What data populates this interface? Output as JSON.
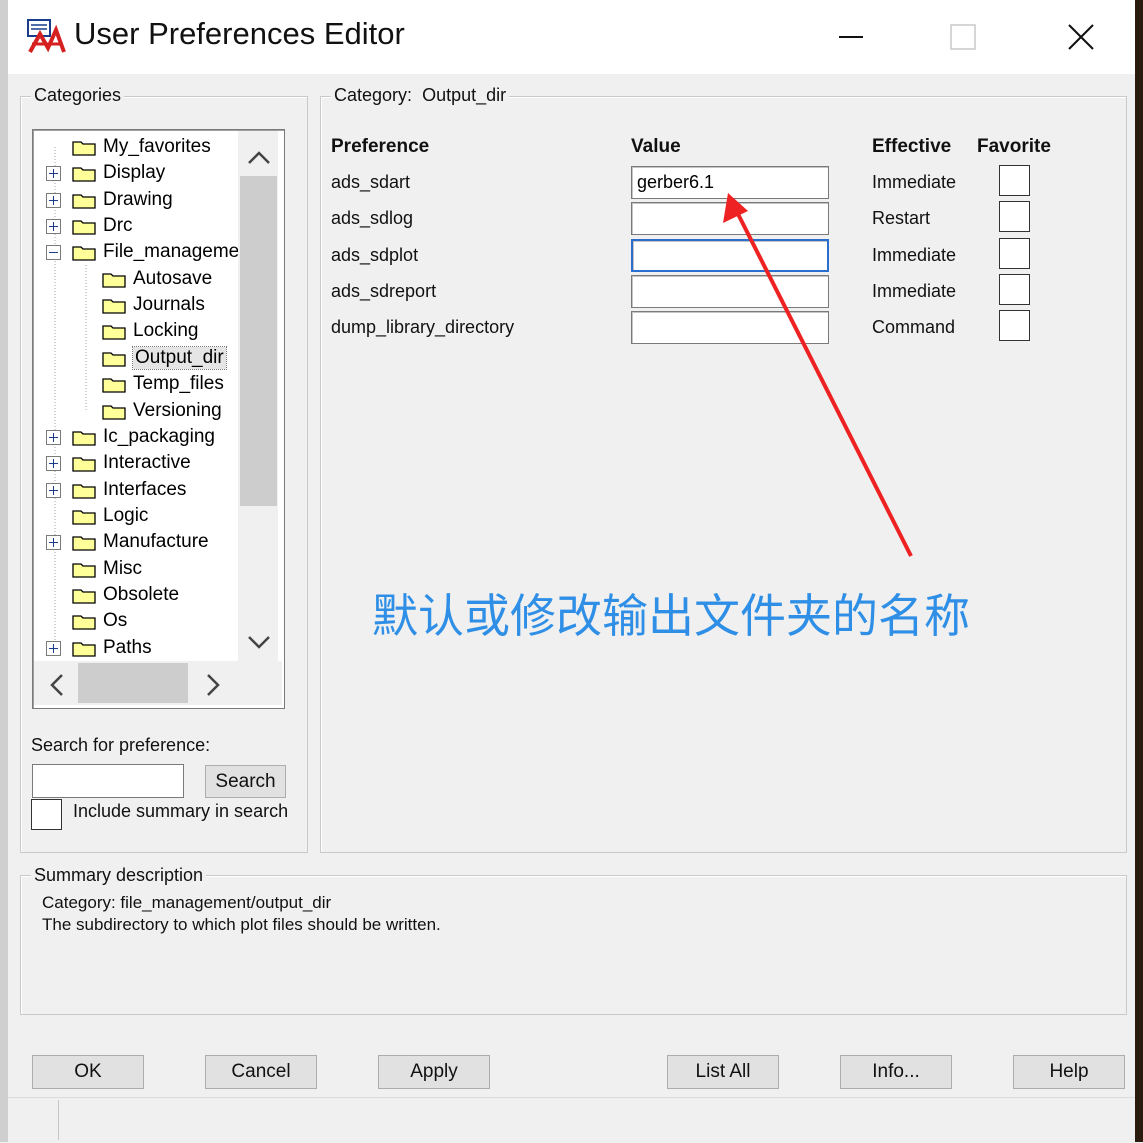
{
  "window": {
    "title": "User Preferences Editor"
  },
  "categories": {
    "label": "Categories",
    "tree": [
      {
        "label": "My_favorites",
        "expander": "none",
        "level": 0
      },
      {
        "label": "Display",
        "expander": "plus",
        "level": 0
      },
      {
        "label": "Drawing",
        "expander": "plus",
        "level": 0
      },
      {
        "label": "Drc",
        "expander": "plus",
        "level": 0
      },
      {
        "label": "File_managemer",
        "expander": "minus",
        "level": 0
      },
      {
        "label": "Autosave",
        "expander": "none",
        "level": 1
      },
      {
        "label": "Journals",
        "expander": "none",
        "level": 1
      },
      {
        "label": "Locking",
        "expander": "none",
        "level": 1
      },
      {
        "label": "Output_dir",
        "expander": "none",
        "level": 1,
        "selected": true
      },
      {
        "label": "Temp_files",
        "expander": "none",
        "level": 1
      },
      {
        "label": "Versioning",
        "expander": "none",
        "level": 1
      },
      {
        "label": "Ic_packaging",
        "expander": "plus",
        "level": 0
      },
      {
        "label": "Interactive",
        "expander": "plus",
        "level": 0
      },
      {
        "label": "Interfaces",
        "expander": "plus",
        "level": 0
      },
      {
        "label": "Logic",
        "expander": "none",
        "level": 0
      },
      {
        "label": "Manufacture",
        "expander": "plus",
        "level": 0
      },
      {
        "label": "Misc",
        "expander": "none",
        "level": 0
      },
      {
        "label": "Obsolete",
        "expander": "none",
        "level": 0
      },
      {
        "label": "Os",
        "expander": "none",
        "level": 0
      },
      {
        "label": "Paths",
        "expander": "plus",
        "level": 0
      }
    ]
  },
  "category_panel": {
    "label": "Category:",
    "name": "Output_dir",
    "columns": {
      "preference": "Preference",
      "value": "Value",
      "effective": "Effective",
      "favorite": "Favorite"
    },
    "rows": [
      {
        "name": "ads_sdart",
        "value": "gerber6.1",
        "effective": "Immediate",
        "favorite": false
      },
      {
        "name": "ads_sdlog",
        "value": "",
        "effective": "Restart",
        "favorite": false
      },
      {
        "name": "ads_sdplot",
        "value": "",
        "effective": "Immediate",
        "favorite": false,
        "focused": true
      },
      {
        "name": "ads_sdreport",
        "value": "",
        "effective": "Immediate",
        "favorite": false
      },
      {
        "name": "dump_library_directory",
        "value": "",
        "effective": "Command",
        "favorite": false
      }
    ]
  },
  "search": {
    "label": "Search for preference:",
    "value": "",
    "button": "Search",
    "include_summary_label": "Include summary in search",
    "include_summary_checked": false
  },
  "summary": {
    "label": "Summary description",
    "line1": "Category: file_management/output_dir",
    "line2": "The subdirectory to which plot files should be written."
  },
  "buttons": {
    "ok": "OK",
    "cancel": "Cancel",
    "apply": "Apply",
    "list_all": "List All",
    "info": "Info...",
    "help": "Help"
  },
  "annotation": {
    "text": "默认或修改输出文件夹的名称",
    "color": "#2f8fe6",
    "arrow_color": "#ee2222"
  },
  "icons": {
    "app": "app-logo-icon",
    "folder": "folder-icon",
    "minimize": "minimize-icon",
    "maximize": "maximize-icon",
    "close": "close-icon"
  }
}
